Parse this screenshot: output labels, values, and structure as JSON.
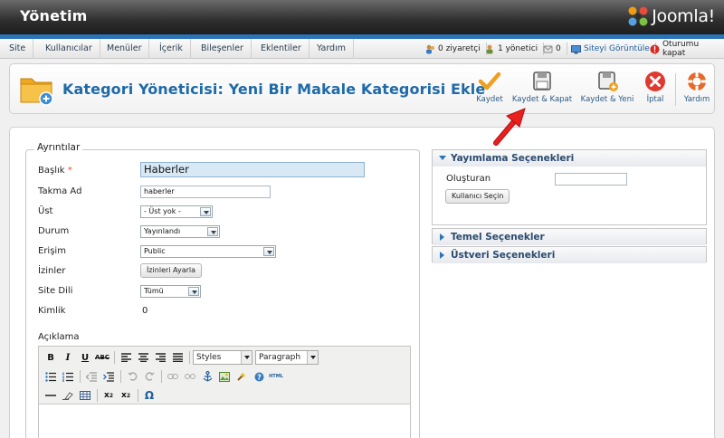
{
  "header": {
    "site_title": "Yönetim",
    "logo_text": "Joomla!"
  },
  "menu": {
    "items": [
      "Site",
      "Kullanıcılar",
      "Menüler",
      "İçerik",
      "Bileşenler",
      "Eklentiler",
      "Yardım"
    ],
    "status": {
      "visitors": "0 ziyaretçi",
      "admins": "1 yönetici",
      "messages": "0",
      "view_site": "Siteyi Görüntüle",
      "logout": "Oturumu kapat"
    }
  },
  "toolbar": {
    "title": "Kategori Yöneticisi: Yeni Bir Makale Kategorisi Ekle",
    "buttons": {
      "save": "Kaydet",
      "save_close": "Kaydet & Kapat",
      "save_new": "Kaydet & Yeni",
      "cancel": "İptal",
      "help": "Yardım"
    }
  },
  "details": {
    "legend": "Ayrıntılar",
    "title_label": "Başlık",
    "required_mark": "*",
    "title_value": "Haberler",
    "alias_label": "Takma Ad",
    "alias_value": "haberler",
    "parent_label": "Üst",
    "parent_value": "- Üst yok -",
    "state_label": "Durum",
    "state_value": "Yayınlandı",
    "access_label": "Erişim",
    "access_value": "Public",
    "permissions_label": "İzinler",
    "permissions_button": "İzinleri Ayarla",
    "language_label": "Site Dili",
    "language_value": "Tümü",
    "id_label": "Kimlik",
    "id_value": "0",
    "description_label": "Açıklama"
  },
  "editor": {
    "styles": "Styles",
    "format": "Paragraph"
  },
  "accordion": {
    "publishing": "Yayımlama Seçenekleri",
    "created_by_label": "Oluşturan",
    "select_user_button": "Kullanıcı Seçin",
    "basic": "Temel Seçenekler",
    "metadata": "Üstveri Seçenekleri"
  },
  "colors": {
    "accent": "#2b74b8",
    "title": "#1f6aa8",
    "arrow": "#d0121b"
  }
}
